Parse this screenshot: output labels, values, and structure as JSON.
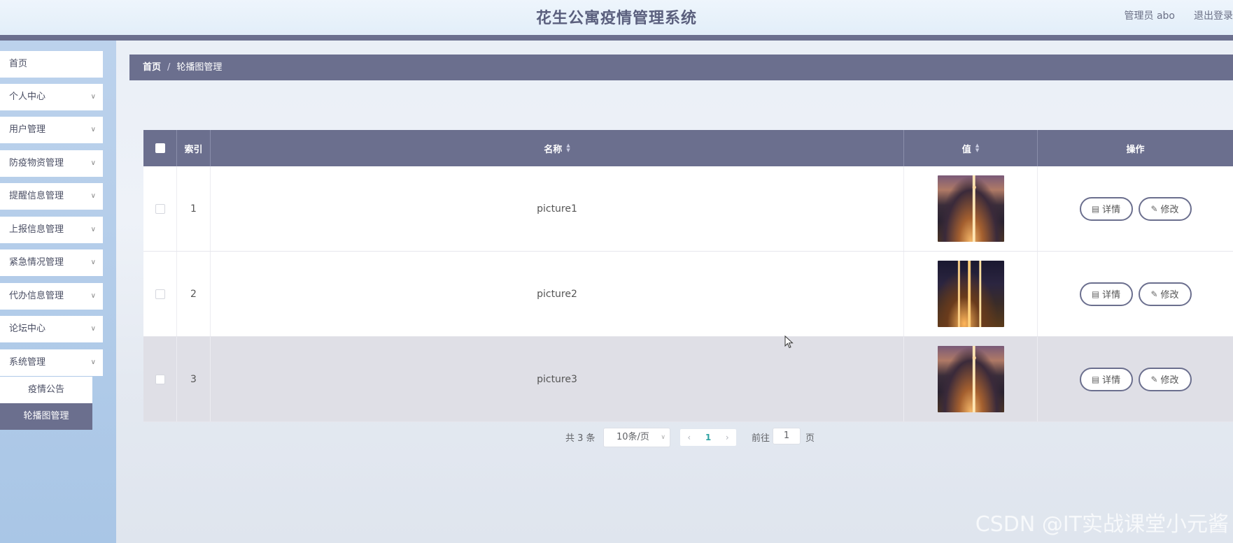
{
  "header": {
    "title": "花生公寓疫情管理系统",
    "user": "管理员 abo",
    "logout": "退出登录"
  },
  "sidebar": {
    "items": [
      {
        "label": "首页",
        "expandable": false
      },
      {
        "label": "个人中心",
        "expandable": true
      },
      {
        "label": "用户管理",
        "expandable": true
      },
      {
        "label": "防疫物资管理",
        "expandable": true
      },
      {
        "label": "提醒信息管理",
        "expandable": true
      },
      {
        "label": "上报信息管理",
        "expandable": true
      },
      {
        "label": "紧急情况管理",
        "expandable": true
      },
      {
        "label": "代办信息管理",
        "expandable": true
      },
      {
        "label": "论坛中心",
        "expandable": true
      },
      {
        "label": "系统管理",
        "expandable": true
      }
    ],
    "submenu": [
      {
        "label": "疫情公告",
        "active": false
      },
      {
        "label": "轮播图管理",
        "active": true
      }
    ]
  },
  "breadcrumb": {
    "home": "首页",
    "separator": "/",
    "current": "轮播图管理"
  },
  "table": {
    "columns": {
      "index": "索引",
      "name": "名称",
      "value": "值",
      "operation": "操作"
    },
    "rows": [
      {
        "index": "1",
        "name": "picture1",
        "thumbnail": "city-night-tower"
      },
      {
        "index": "2",
        "name": "picture2",
        "thumbnail": "city-night-skyline"
      },
      {
        "index": "3",
        "name": "picture3",
        "thumbnail": "city-night-tower"
      }
    ],
    "detail_label": "详情",
    "edit_label": "修改"
  },
  "pagination": {
    "total": "共 3 条",
    "page_size": "10条/页",
    "current_page": "1",
    "goto_label": "前往",
    "goto_value": "1",
    "page_suffix": "页"
  },
  "watermark": "CSDN @IT实战课堂小元酱",
  "colors": {
    "accent": "#6b6f8e",
    "sidebar_bg": "#a9c6e6",
    "active_page": "#2fa3a3"
  }
}
